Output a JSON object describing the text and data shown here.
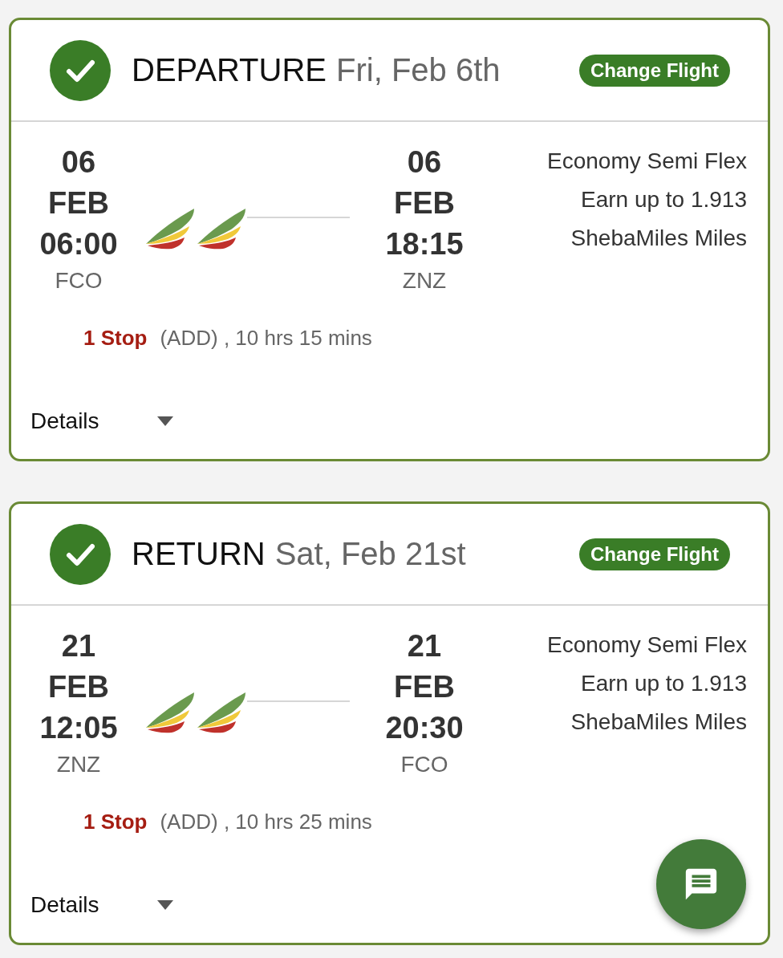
{
  "flights": [
    {
      "confirmed": true,
      "label": "DEPARTURE",
      "date": "Fri, Feb 6th",
      "change_button": "Change Flight",
      "departure": {
        "day": "06",
        "month": "FEB",
        "time": "06:00",
        "airport": "FCO"
      },
      "arrival": {
        "day": "06",
        "month": "FEB",
        "time": "18:15",
        "airport": "ZNZ"
      },
      "fare_class": "Economy Semi Flex",
      "miles_lines": [
        "Earn up to 1.913",
        "ShebaMiles Miles"
      ],
      "stops": "1 Stop",
      "stop_info": "(ADD) , 10 hrs 15 mins",
      "details": {
        "label": "Details",
        "expanded": false
      }
    },
    {
      "confirmed": true,
      "label": "RETURN",
      "date": "Sat, Feb 21st",
      "change_button": "Change Flight",
      "departure": {
        "day": "21",
        "month": "FEB",
        "time": "12:05",
        "airport": "ZNZ"
      },
      "arrival": {
        "day": "21",
        "month": "FEB",
        "time": "20:30",
        "airport": "FCO"
      },
      "fare_class": "Economy Semi Flex",
      "miles_lines": [
        "Earn up to 1.913",
        "ShebaMiles Miles"
      ],
      "stops": "1 Stop",
      "stop_info": "(ADD) , 10 hrs 25 mins",
      "details": {
        "label": "Details",
        "expanded": false
      }
    }
  ]
}
